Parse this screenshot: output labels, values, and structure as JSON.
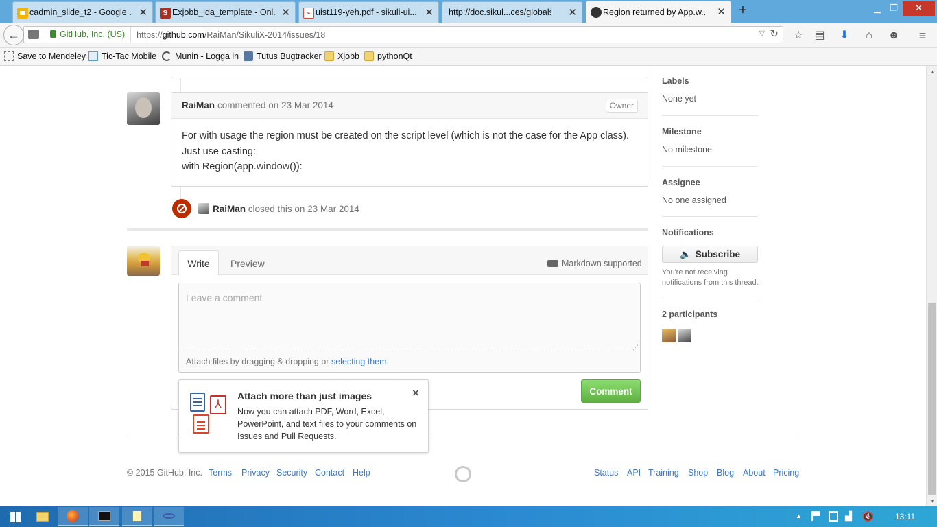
{
  "browser": {
    "tabs": [
      {
        "title": "cadmin_slide_t2 - Google ...",
        "icon": "slides-icon",
        "color": "#f4b400"
      },
      {
        "title": "Exjobb_ida_template - Onl...",
        "icon": "sharelatex-icon",
        "color": "#a93226"
      },
      {
        "title": "uist119-yeh.pdf - sikuli-ui...",
        "icon": "pdf-icon",
        "color": "#d14836"
      },
      {
        "title": "http://doc.sikul...ces/globals.txt",
        "icon": "",
        "color": ""
      },
      {
        "title": "Region returned by App.w...",
        "icon": "github-icon",
        "color": "#333333"
      }
    ],
    "new_tab": "+",
    "identity": "GitHub, Inc. (US)",
    "url_prefix": "https://",
    "url_host": "github.com",
    "url_path": "/RaiMan/SikuliX-2014/issues/18",
    "bookmarks": [
      "Save to Mendeley",
      "Tic-Tac Mobile",
      "Munin - Logga in",
      "Tutus Bugtracker",
      "Xjobb",
      "pythonQt"
    ]
  },
  "issue": {
    "comment": {
      "author": "RaiMan",
      "meta": "commented on 23 Mar 2014",
      "badge": "Owner",
      "lines": [
        "For with usage the region must be created on the script level (which is not the case for the App class).",
        "Just use casting:",
        "with Region(app.window()):"
      ]
    },
    "event": {
      "author": "RaiMan",
      "text": "closed this on 23 Mar 2014"
    },
    "new_comment": {
      "tab_write": "Write",
      "tab_preview": "Preview",
      "markdown": "Markdown supported",
      "placeholder": "Leave a comment",
      "attach_text": "Attach files by dragging & dropping or",
      "attach_link": "selecting them.",
      "submit": "Comment"
    },
    "popup": {
      "title": "Attach more than just images",
      "body": "Now you can attach PDF, Word, Excel, PowerPoint, and text files to your comments on Issues and Pull Requests.",
      "close": "×"
    }
  },
  "sidebar": {
    "labels_title": "Labels",
    "labels_value": "None yet",
    "milestone_title": "Milestone",
    "milestone_value": "No milestone",
    "assignee_title": "Assignee",
    "assignee_value": "No one assigned",
    "notifications_title": "Notifications",
    "subscribe": "Subscribe",
    "notif_note": "You're not receiving notifications from this thread.",
    "participants": "2 participants"
  },
  "footer": {
    "copyright": "© 2015 GitHub, Inc.",
    "left_links": [
      "Terms",
      "Privacy",
      "Security",
      "Contact",
      "Help"
    ],
    "right_links": [
      "Status",
      "API",
      "Training",
      "Shop",
      "Blog",
      "About",
      "Pricing"
    ]
  },
  "taskbar": {
    "clock": "13:11"
  }
}
